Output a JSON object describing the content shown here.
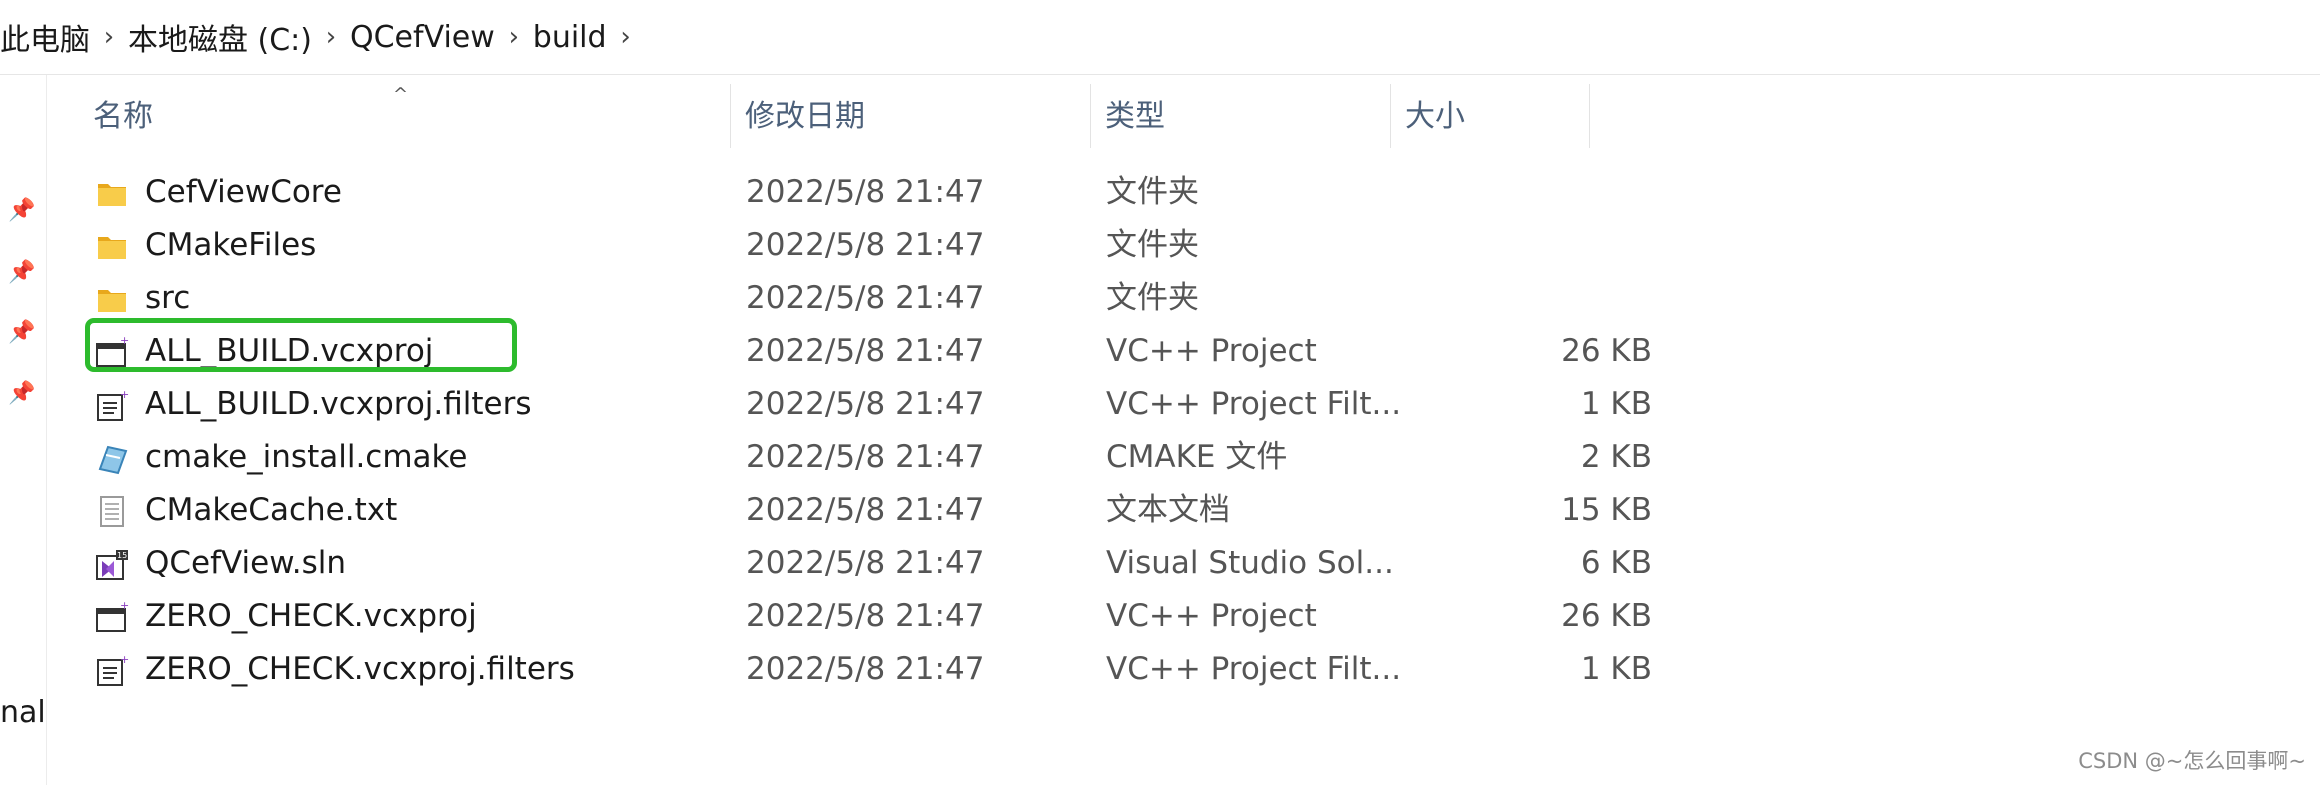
{
  "breadcrumb": [
    {
      "label": "此电脑"
    },
    {
      "label": "本地磁盘 (C:)"
    },
    {
      "label": "QCefView"
    },
    {
      "label": "build"
    }
  ],
  "columns": {
    "name": "名称",
    "date": "修改日期",
    "type": "类型",
    "size": "大小"
  },
  "nav_partial_text": "nal",
  "files": [
    {
      "name": "CefViewCore",
      "date": "2022/5/8 21:47",
      "type": "文件夹",
      "size": "",
      "icon": "folder-icon"
    },
    {
      "name": "CMakeFiles",
      "date": "2022/5/8 21:47",
      "type": "文件夹",
      "size": "",
      "icon": "folder-icon"
    },
    {
      "name": "src",
      "date": "2022/5/8 21:47",
      "type": "文件夹",
      "size": "",
      "icon": "folder-icon"
    },
    {
      "name": "ALL_BUILD.vcxproj",
      "date": "2022/5/8 21:47",
      "type": "VC++ Project",
      "size": "26 KB",
      "icon": "vcxproj-icon"
    },
    {
      "name": "ALL_BUILD.vcxproj.filters",
      "date": "2022/5/8 21:47",
      "type": "VC++ Project Filt...",
      "size": "1 KB",
      "icon": "filters-icon"
    },
    {
      "name": "cmake_install.cmake",
      "date": "2022/5/8 21:47",
      "type": "CMAKE 文件",
      "size": "2 KB",
      "icon": "cmake-file-icon"
    },
    {
      "name": "CMakeCache.txt",
      "date": "2022/5/8 21:47",
      "type": "文本文档",
      "size": "15 KB",
      "icon": "text-file-icon"
    },
    {
      "name": "QCefView.sln",
      "date": "2022/5/8 21:47",
      "type": "Visual Studio Sol...",
      "size": "6 KB",
      "icon": "vs-solution-icon"
    },
    {
      "name": "ZERO_CHECK.vcxproj",
      "date": "2022/5/8 21:47",
      "type": "VC++ Project",
      "size": "26 KB",
      "icon": "vcxproj-icon"
    },
    {
      "name": "ZERO_CHECK.vcxproj.filters",
      "date": "2022/5/8 21:47",
      "type": "VC++ Project Filt...",
      "size": "1 KB",
      "icon": "filters-icon"
    }
  ],
  "highlighted_file": "ALL_BUILD.vcxproj",
  "colors": {
    "highlight": "#2dbb2d",
    "folder": "#f4c542",
    "header_text": "#4c607a"
  },
  "watermark": "CSDN @~怎么回事啊~"
}
